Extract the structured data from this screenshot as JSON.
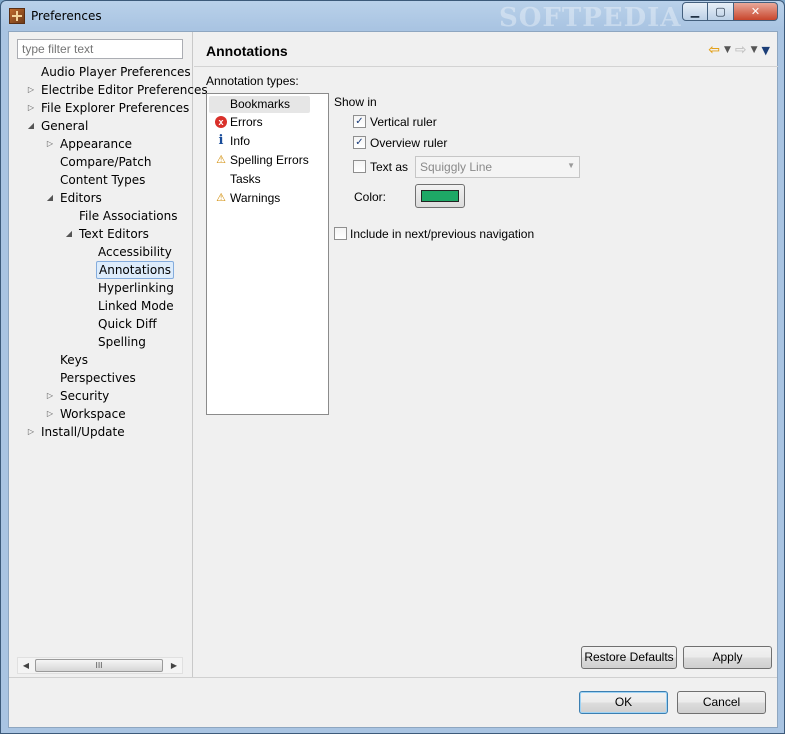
{
  "window": {
    "title": "Preferences",
    "watermark": "SOFTPEDIA"
  },
  "window_controls": {
    "minimize": "▁",
    "maximize": "▢",
    "close": "✕"
  },
  "filter": {
    "placeholder": "type filter text"
  },
  "tree": [
    {
      "label": "Audio Player Preferences",
      "twisty": ""
    },
    {
      "label": "Electribe Editor Preferences",
      "twisty": "▷"
    },
    {
      "label": "File Explorer Preferences",
      "twisty": "▷"
    },
    {
      "label": "General",
      "twisty": "◢"
    },
    {
      "label": "Appearance",
      "twisty": "▷"
    },
    {
      "label": "Compare/Patch",
      "twisty": ""
    },
    {
      "label": "Content Types",
      "twisty": ""
    },
    {
      "label": "Editors",
      "twisty": "◢"
    },
    {
      "label": "File Associations",
      "twisty": ""
    },
    {
      "label": "Text Editors",
      "twisty": "◢"
    },
    {
      "label": "Accessibility",
      "twisty": ""
    },
    {
      "label": "Annotations",
      "twisty": "",
      "selected": true
    },
    {
      "label": "Hyperlinking",
      "twisty": ""
    },
    {
      "label": "Linked Mode",
      "twisty": ""
    },
    {
      "label": "Quick Diff",
      "twisty": ""
    },
    {
      "label": "Spelling",
      "twisty": ""
    },
    {
      "label": "Keys",
      "twisty": ""
    },
    {
      "label": "Perspectives",
      "twisty": ""
    },
    {
      "label": "Security",
      "twisty": "▷"
    },
    {
      "label": "Workspace",
      "twisty": "▷"
    },
    {
      "label": "Install/Update",
      "twisty": "▷"
    }
  ],
  "hscroll": {
    "left": "◀",
    "right": "▶",
    "grip": "III"
  },
  "page": {
    "title": "Annotations",
    "back": "⇦",
    "forward": "⇨",
    "menu": "▼",
    "view_menu": "▼"
  },
  "annotation_types": {
    "label": "Annotation types:",
    "items": [
      {
        "label": "Bookmarks",
        "icon": "",
        "selected": true
      },
      {
        "label": "Errors",
        "icon": "x"
      },
      {
        "label": "Info",
        "icon": "i"
      },
      {
        "label": "Spelling Errors",
        "icon": "⚠"
      },
      {
        "label": "Tasks",
        "icon": ""
      },
      {
        "label": "Warnings",
        "icon": "⚠"
      }
    ]
  },
  "show_in": {
    "label": "Show in",
    "vertical_ruler": {
      "label": "Vertical ruler",
      "checked": true
    },
    "overview_ruler": {
      "label": "Overview ruler",
      "checked": true
    },
    "text_as": {
      "label": "Text as",
      "checked": false,
      "value": "Squiggly Line"
    },
    "color": {
      "label": "Color:",
      "value": "#1ea866"
    },
    "include_nav": {
      "label": "Include in next/previous navigation",
      "checked": false
    }
  },
  "check_mark": "✓",
  "buttons": {
    "restore_defaults": "Restore Defaults",
    "apply": "Apply",
    "ok": "OK",
    "cancel": "Cancel"
  }
}
